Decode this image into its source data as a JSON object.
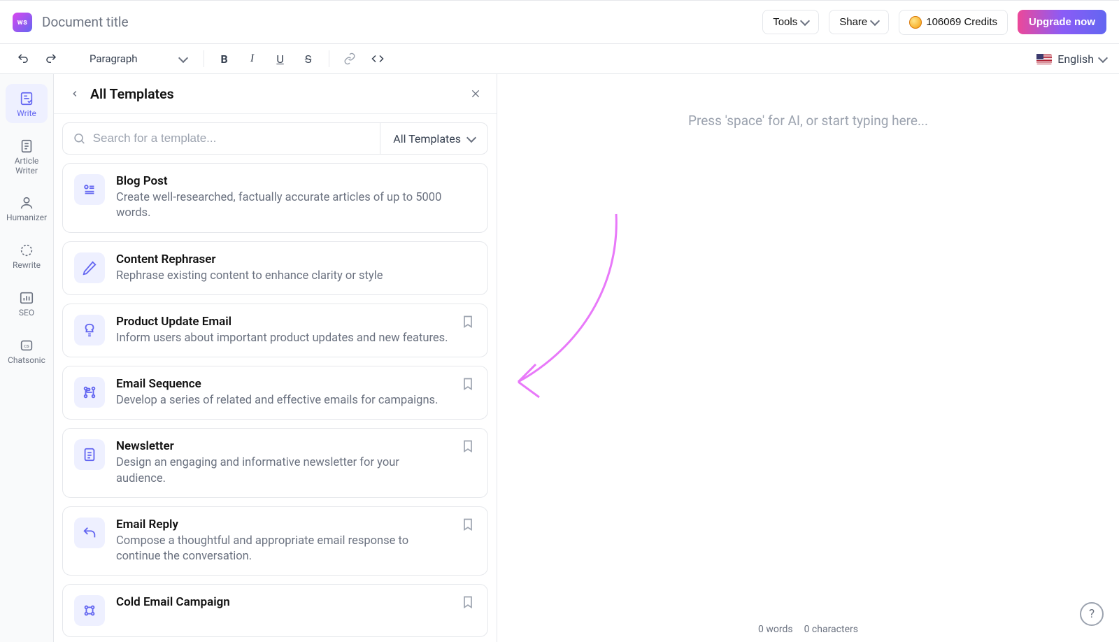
{
  "header": {
    "doc_title": "Document title",
    "tools_label": "Tools",
    "share_label": "Share",
    "credits_label": "106069 Credits",
    "upgrade_label": "Upgrade now"
  },
  "toolbar": {
    "format_label": "Paragraph",
    "language_label": "English"
  },
  "sidebar": {
    "items": [
      {
        "label": "Write"
      },
      {
        "label": "Article Writer"
      },
      {
        "label": "Humanizer"
      },
      {
        "label": "Rewrite"
      },
      {
        "label": "SEO"
      },
      {
        "label": "Chatsonic"
      }
    ]
  },
  "templates": {
    "title": "All Templates",
    "search_placeholder": "Search for a template...",
    "filter_label": "All Templates",
    "items": [
      {
        "name": "Blog Post",
        "desc": "Create well-researched, factually accurate articles of up to 5000 words."
      },
      {
        "name": "Content Rephraser",
        "desc": "Rephrase existing content to enhance clarity or style"
      },
      {
        "name": "Product Update Email",
        "desc": "Inform users about important product updates and new features."
      },
      {
        "name": "Email Sequence",
        "desc": "Develop a series of related and effective emails for campaigns."
      },
      {
        "name": "Newsletter",
        "desc": "Design an engaging and informative newsletter for your audience."
      },
      {
        "name": "Email Reply",
        "desc": "Compose a thoughtful and appropriate email response to continue the conversation."
      },
      {
        "name": "Cold Email Campaign",
        "desc": ""
      }
    ]
  },
  "editor": {
    "placeholder": "Press 'space' for AI, or start typing here...",
    "words_label": "0 words",
    "chars_label": "0 characters"
  }
}
